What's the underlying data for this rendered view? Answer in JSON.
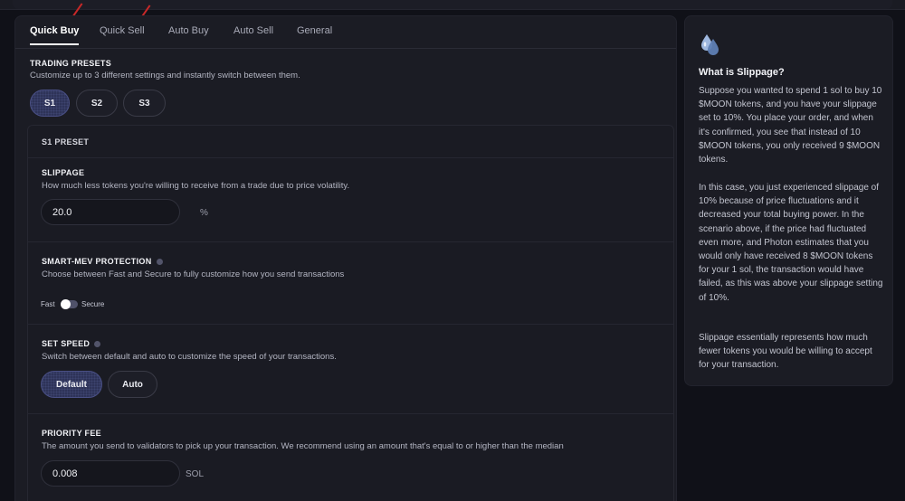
{
  "tabs": [
    {
      "label": "Quick Buy",
      "active": true
    },
    {
      "label": "Quick Sell",
      "active": false
    },
    {
      "label": "Auto Buy",
      "active": false
    },
    {
      "label": "Auto Sell",
      "active": false
    },
    {
      "label": "General",
      "active": false
    }
  ],
  "annotation_color": "#c62828",
  "trading_presets": {
    "title": "TRADING PRESETS",
    "description": "Customize up to 3 different settings and instantly switch between them.",
    "buttons": [
      "S1",
      "S2",
      "S3"
    ],
    "selected": "S1"
  },
  "preset": {
    "header": "S1 PRESET",
    "slippage": {
      "title": "SLIPPAGE",
      "description": "How much less tokens you're willing to receive from a trade due to price volatility.",
      "value": "20.0",
      "unit": "%"
    },
    "mev": {
      "title": "SMART-MEV PROTECTION",
      "description": "Choose between Fast and Secure to fully customize how you send transactions",
      "left_label": "Fast",
      "right_label": "Secure",
      "icon": "info-icon"
    },
    "speed": {
      "title": "SET SPEED",
      "description": "Switch between default and auto to customize the speed of your transactions.",
      "options": [
        "Default",
        "Auto"
      ],
      "selected": "Default",
      "icon": "info-icon"
    },
    "priority_fee": {
      "title": "PRIORITY FEE",
      "description": "The amount you send to validators to pick up your transaction. We recommend using an amount that's equal to or higher than the median",
      "value": "0.008",
      "unit": "SOL"
    }
  },
  "side": {
    "icon": "droplets-icon",
    "title": "What is Slippage?",
    "p1": "Suppose you wanted to spend 1 sol to buy 10 $MOON tokens, and you have your slippage set to 10%. You place your order, and when it's confirmed, you see that instead of 10 $MOON tokens, you only received 9 $MOON tokens.",
    "p2": "In this case, you just experienced slippage of 10% because of price fluctuations and it decreased your total buying power. In the scenario above, if the price had fluctuated even more, and Photon estimates that you would only have received 8 $MOON tokens for your 1 sol, the transaction would have failed, as this was above your slippage setting of 10%.",
    "p3": "Slippage essentially represents how much fewer tokens you would be willing to accept for your transaction."
  }
}
